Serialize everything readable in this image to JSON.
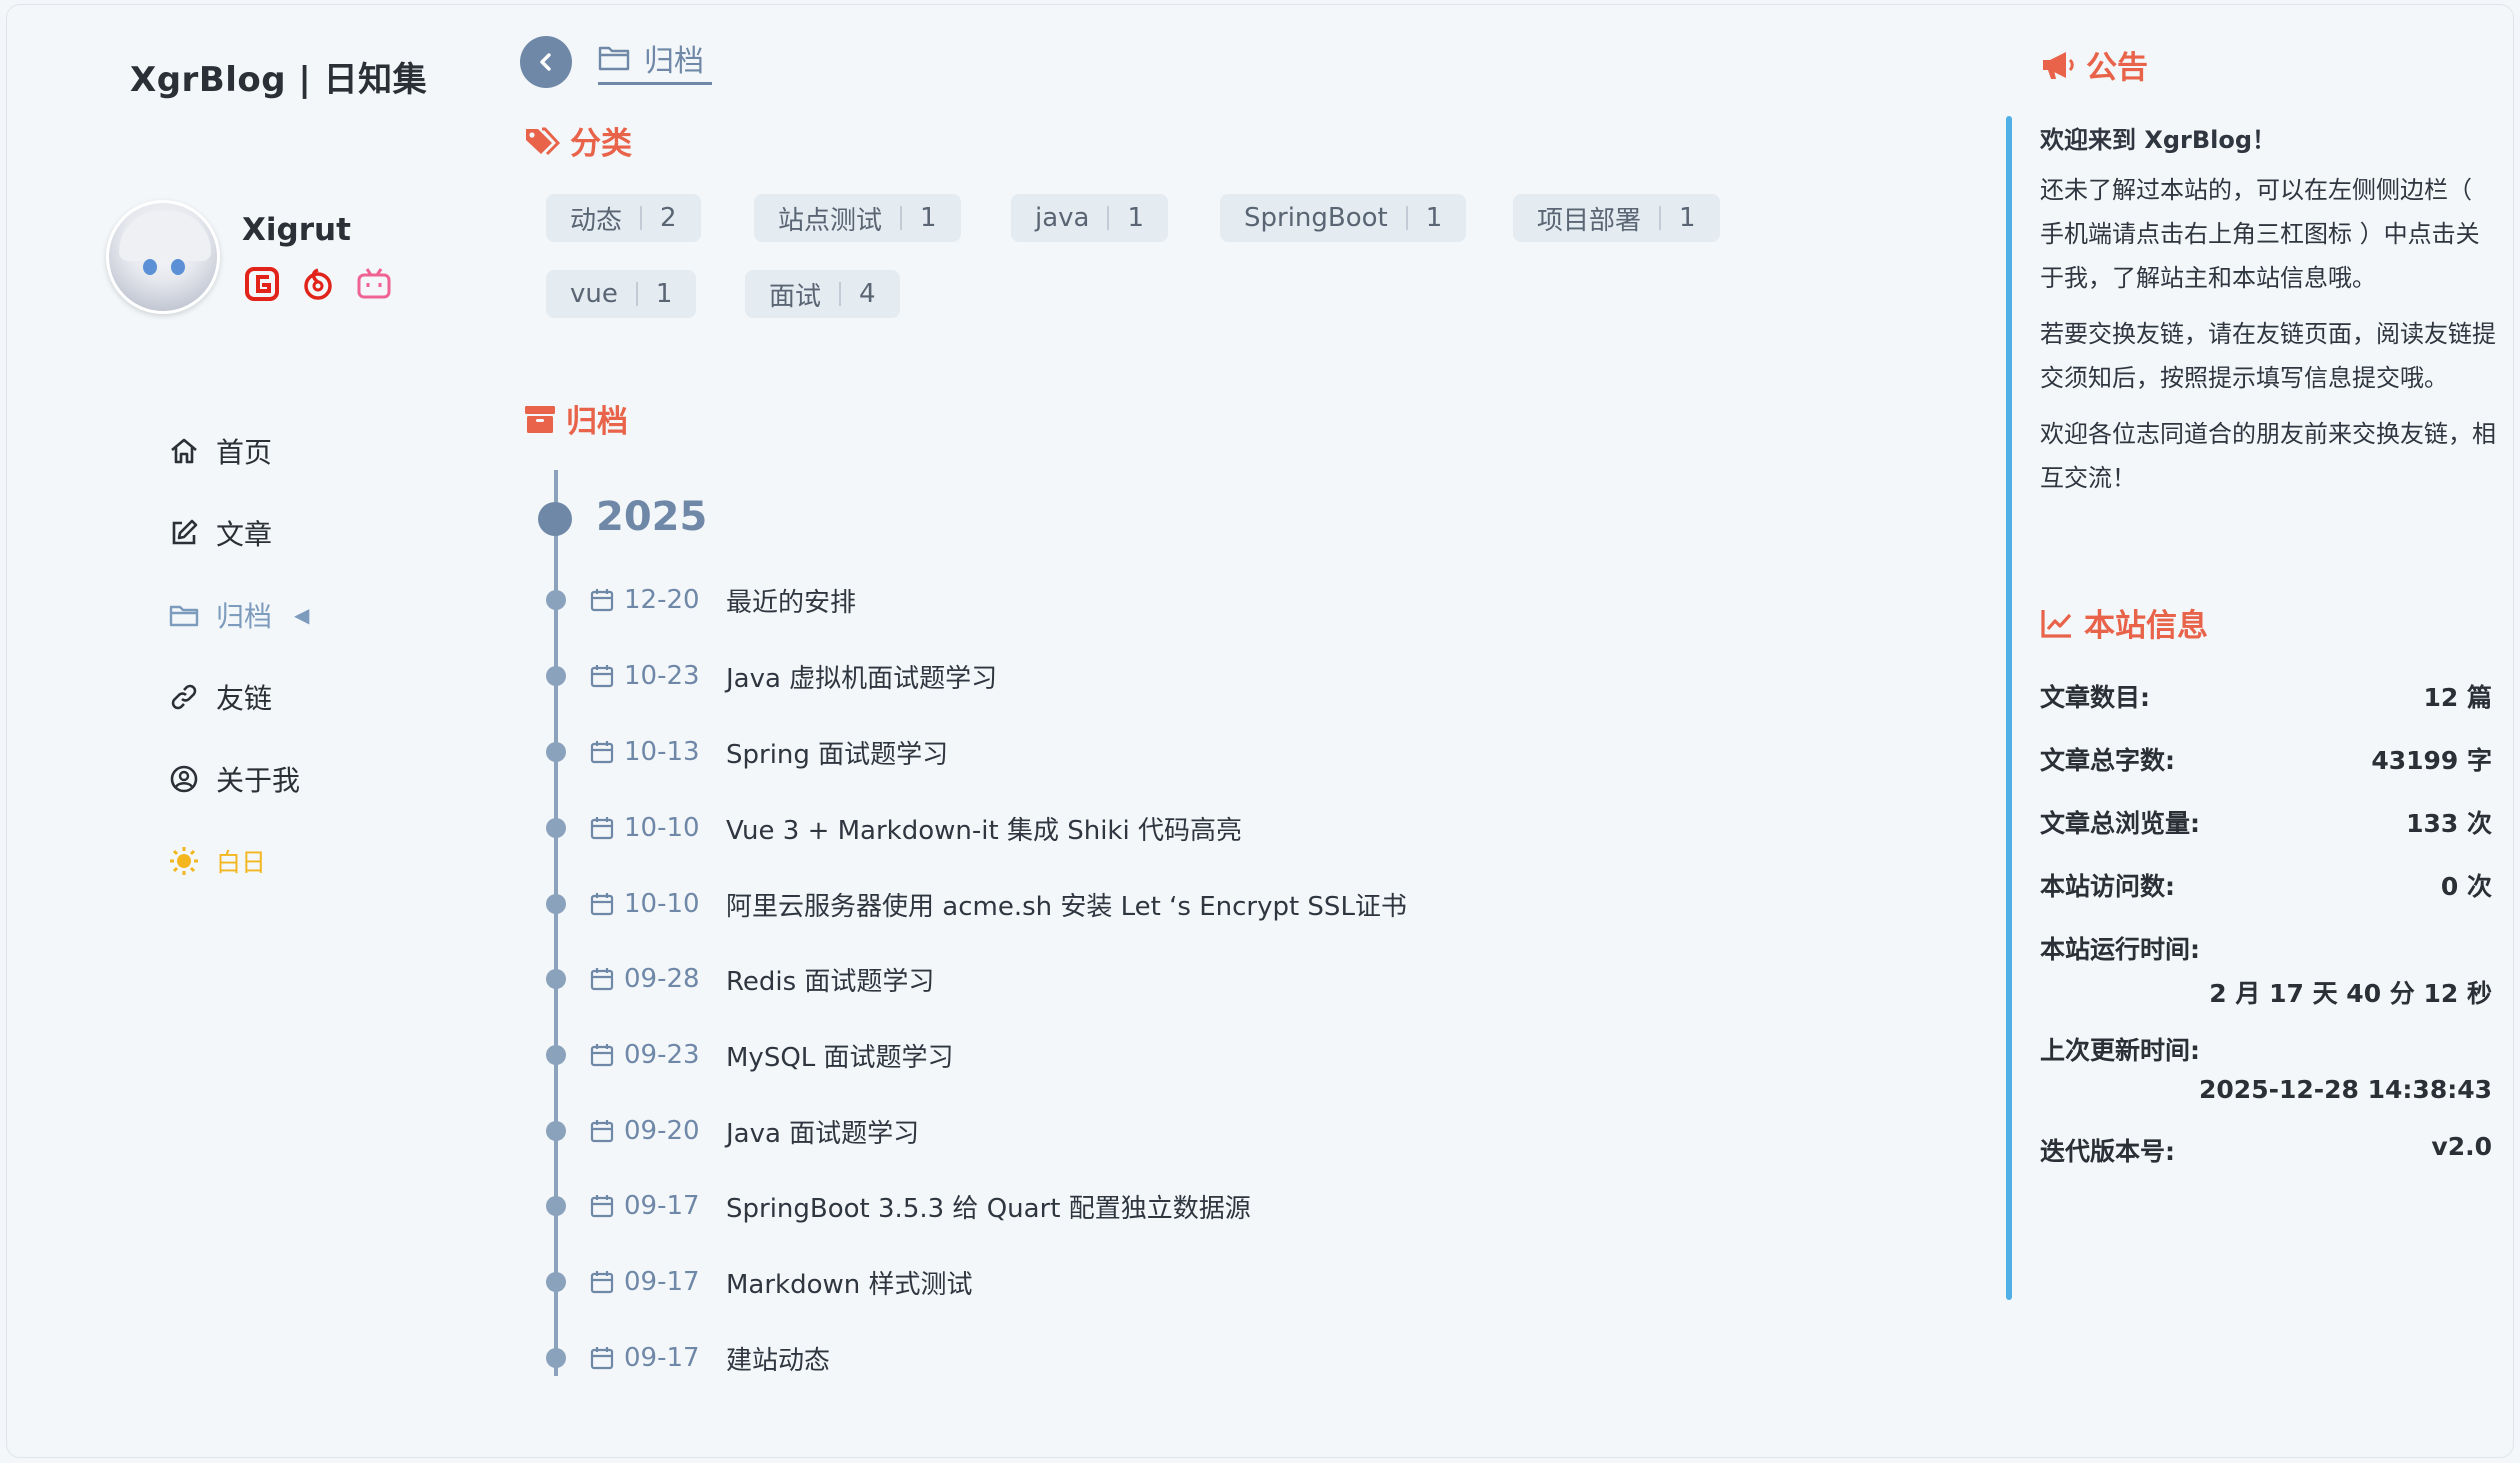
{
  "site": {
    "title": "XgrBlog | 日知集"
  },
  "profile": {
    "name": "Xigrut",
    "socials": [
      {
        "icon": "gitee-icon",
        "color": "#e2231a"
      },
      {
        "icon": "netease-music-icon",
        "color": "#e2231a"
      },
      {
        "icon": "bilibili-icon",
        "color": "#f06292"
      }
    ]
  },
  "nav": [
    {
      "label": "首页",
      "icon": "home-icon"
    },
    {
      "label": "文章",
      "icon": "edit-icon"
    },
    {
      "label": "归档",
      "icon": "folder-icon",
      "active": true
    },
    {
      "label": "友链",
      "icon": "link-icon"
    },
    {
      "label": "关于我",
      "icon": "user-circle-icon"
    },
    {
      "label": "白日",
      "icon": "sun-icon"
    }
  ],
  "header": {
    "tab_label": "归档"
  },
  "categories": {
    "title": "分类",
    "tags": [
      {
        "name": "动态",
        "count": "2"
      },
      {
        "name": "站点测试",
        "count": "1"
      },
      {
        "name": "java",
        "count": "1"
      },
      {
        "name": "SpringBoot",
        "count": "1"
      },
      {
        "name": "项目部署",
        "count": "1"
      },
      {
        "name": "vue",
        "count": "1"
      },
      {
        "name": "面试",
        "count": "4"
      }
    ]
  },
  "archive": {
    "title": "归档",
    "year": "2025",
    "posts": [
      {
        "date": "12-20",
        "title": "最近的安排"
      },
      {
        "date": "10-23",
        "title": "Java 虚拟机面试题学习"
      },
      {
        "date": "10-13",
        "title": "Spring 面试题学习"
      },
      {
        "date": "10-10",
        "title": "Vue 3 + Markdown-it  集成 Shiki 代码高亮"
      },
      {
        "date": "10-10",
        "title": "阿里云服务器使用 acme.sh 安装 Let ‘s Encrypt  SSL证书"
      },
      {
        "date": "09-28",
        "title": "Redis 面试题学习"
      },
      {
        "date": "09-23",
        "title": "MySQL 面试题学习"
      },
      {
        "date": "09-20",
        "title": "Java 面试题学习"
      },
      {
        "date": "09-17",
        "title": "SpringBoot  3.5.3 给 Quart  配置独立数据源"
      },
      {
        "date": "09-17",
        "title": "Markdown 样式测试"
      },
      {
        "date": "09-17",
        "title": "建站动态"
      }
    ]
  },
  "notice": {
    "title": "公告",
    "welcome": "欢迎来到 XgrBlog！",
    "paragraphs": [
      "还未了解过本站的，可以在左侧侧边栏（ 手机端请点击右上角三杠图标 ）中点击关于我，了解站主和本站信息哦。",
      "若要交换友链，请在友链页面，阅读友链提交须知后，按照提示填写信息提交哦。",
      "欢迎各位志同道合的朋友前来交换友链，相互交流！"
    ]
  },
  "stats": {
    "title": "本站信息",
    "articles_label": "文章数目:",
    "articles_value": "12 篇",
    "words_label": "文章总字数:",
    "words_value": "43199 字",
    "views_label": "文章总浏览量:",
    "views_value": "133 次",
    "visits_label": "本站访问数:",
    "visits_value": "0 次",
    "runtime_label": "本站运行时间:",
    "runtime_value": "2 月 17 天 40 分 12 秒",
    "updated_label": "上次更新时间:",
    "updated_value": "2025-12-28 14:38:43",
    "version_label": "迭代版本号:",
    "version_value": "v2.0"
  },
  "colors": {
    "accent": "#e8634a",
    "primary": "#6f88a8",
    "notice_bar": "#4fb0e8",
    "theme_sun": "#f3b61f"
  }
}
